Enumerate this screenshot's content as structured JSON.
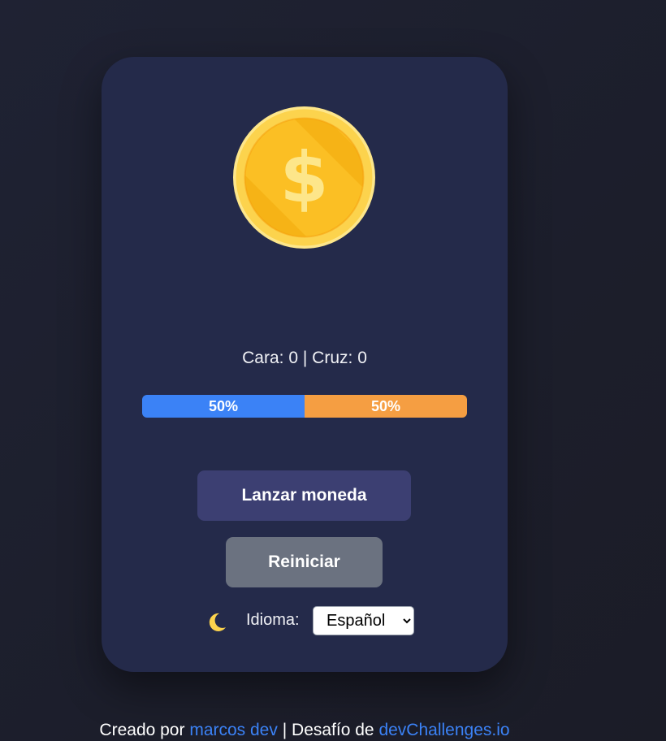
{
  "score": {
    "heads_label": "Cara",
    "heads_count": "0",
    "separator": "|",
    "tails_label": "Cruz",
    "tails_count": "0"
  },
  "progress": {
    "heads_percent": 50,
    "tails_percent": 50,
    "heads_text": "50%",
    "tails_text": "50%",
    "heads_color": "#3b82f6",
    "tails_color": "#f59e42"
  },
  "buttons": {
    "flip_label": "Lanzar moneda",
    "reset_label": "Reiniciar"
  },
  "theme": {
    "icon": "moon-icon",
    "moon_color": "#fcd34d"
  },
  "language": {
    "label": "Idioma:",
    "selected": "Español"
  },
  "coin": {
    "icon": "dollar-coin-icon",
    "rim_color": "#fcd34d",
    "face_color": "#fbbf24",
    "symbol": "$"
  },
  "footer": {
    "created_by": "Creado por",
    "author": "marcos dev",
    "separator": "|",
    "challenge_text": "Desafío de",
    "challenge_link": "devChallenges.io",
    "link_color": "#3b82f6"
  }
}
